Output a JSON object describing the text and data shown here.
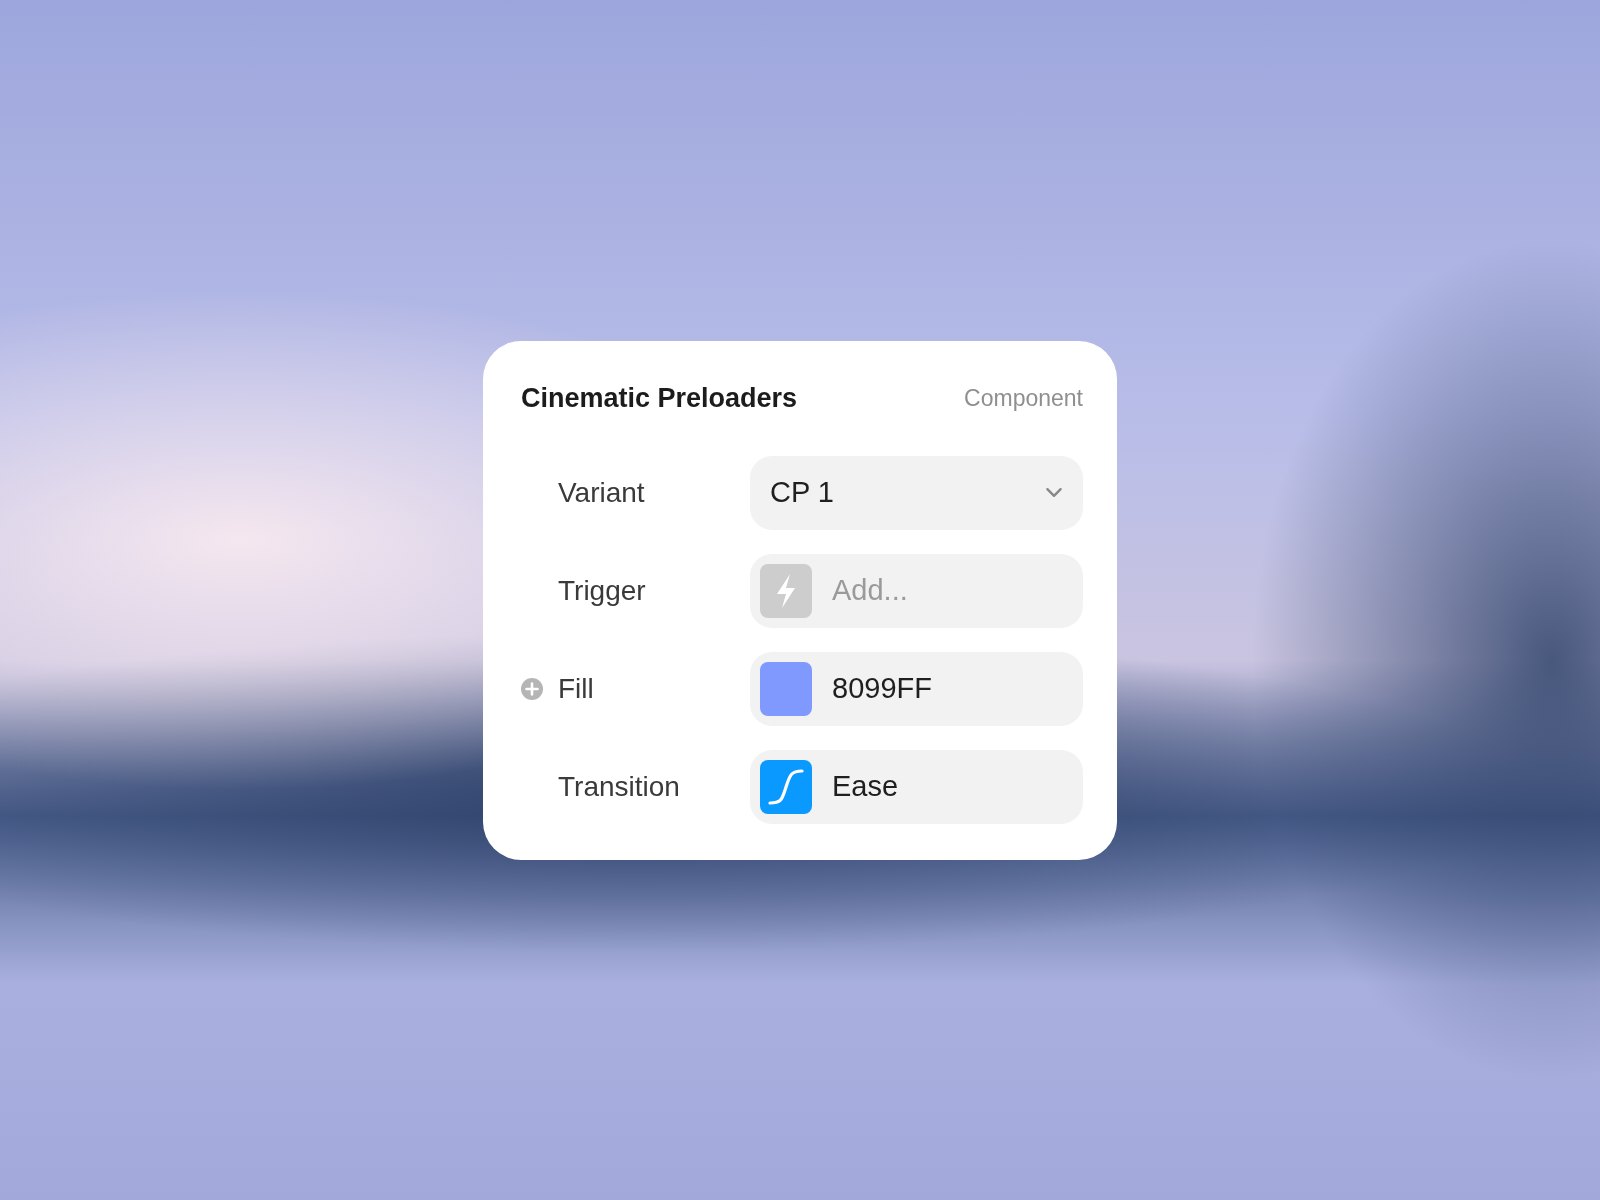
{
  "panel": {
    "title": "Cinematic Preloaders",
    "subtitle": "Component"
  },
  "rows": [
    {
      "kind": "select",
      "label": "Variant",
      "value": "CP 1",
      "add_button": false
    },
    {
      "kind": "trigger",
      "label": "Trigger",
      "placeholder": "Add...",
      "add_button": false
    },
    {
      "kind": "color",
      "label": "Fill",
      "value": "8099FF",
      "color": "#8099ff",
      "add_button": true
    },
    {
      "kind": "easing",
      "label": "Transition",
      "value": "Ease",
      "add_button": false
    }
  ]
}
